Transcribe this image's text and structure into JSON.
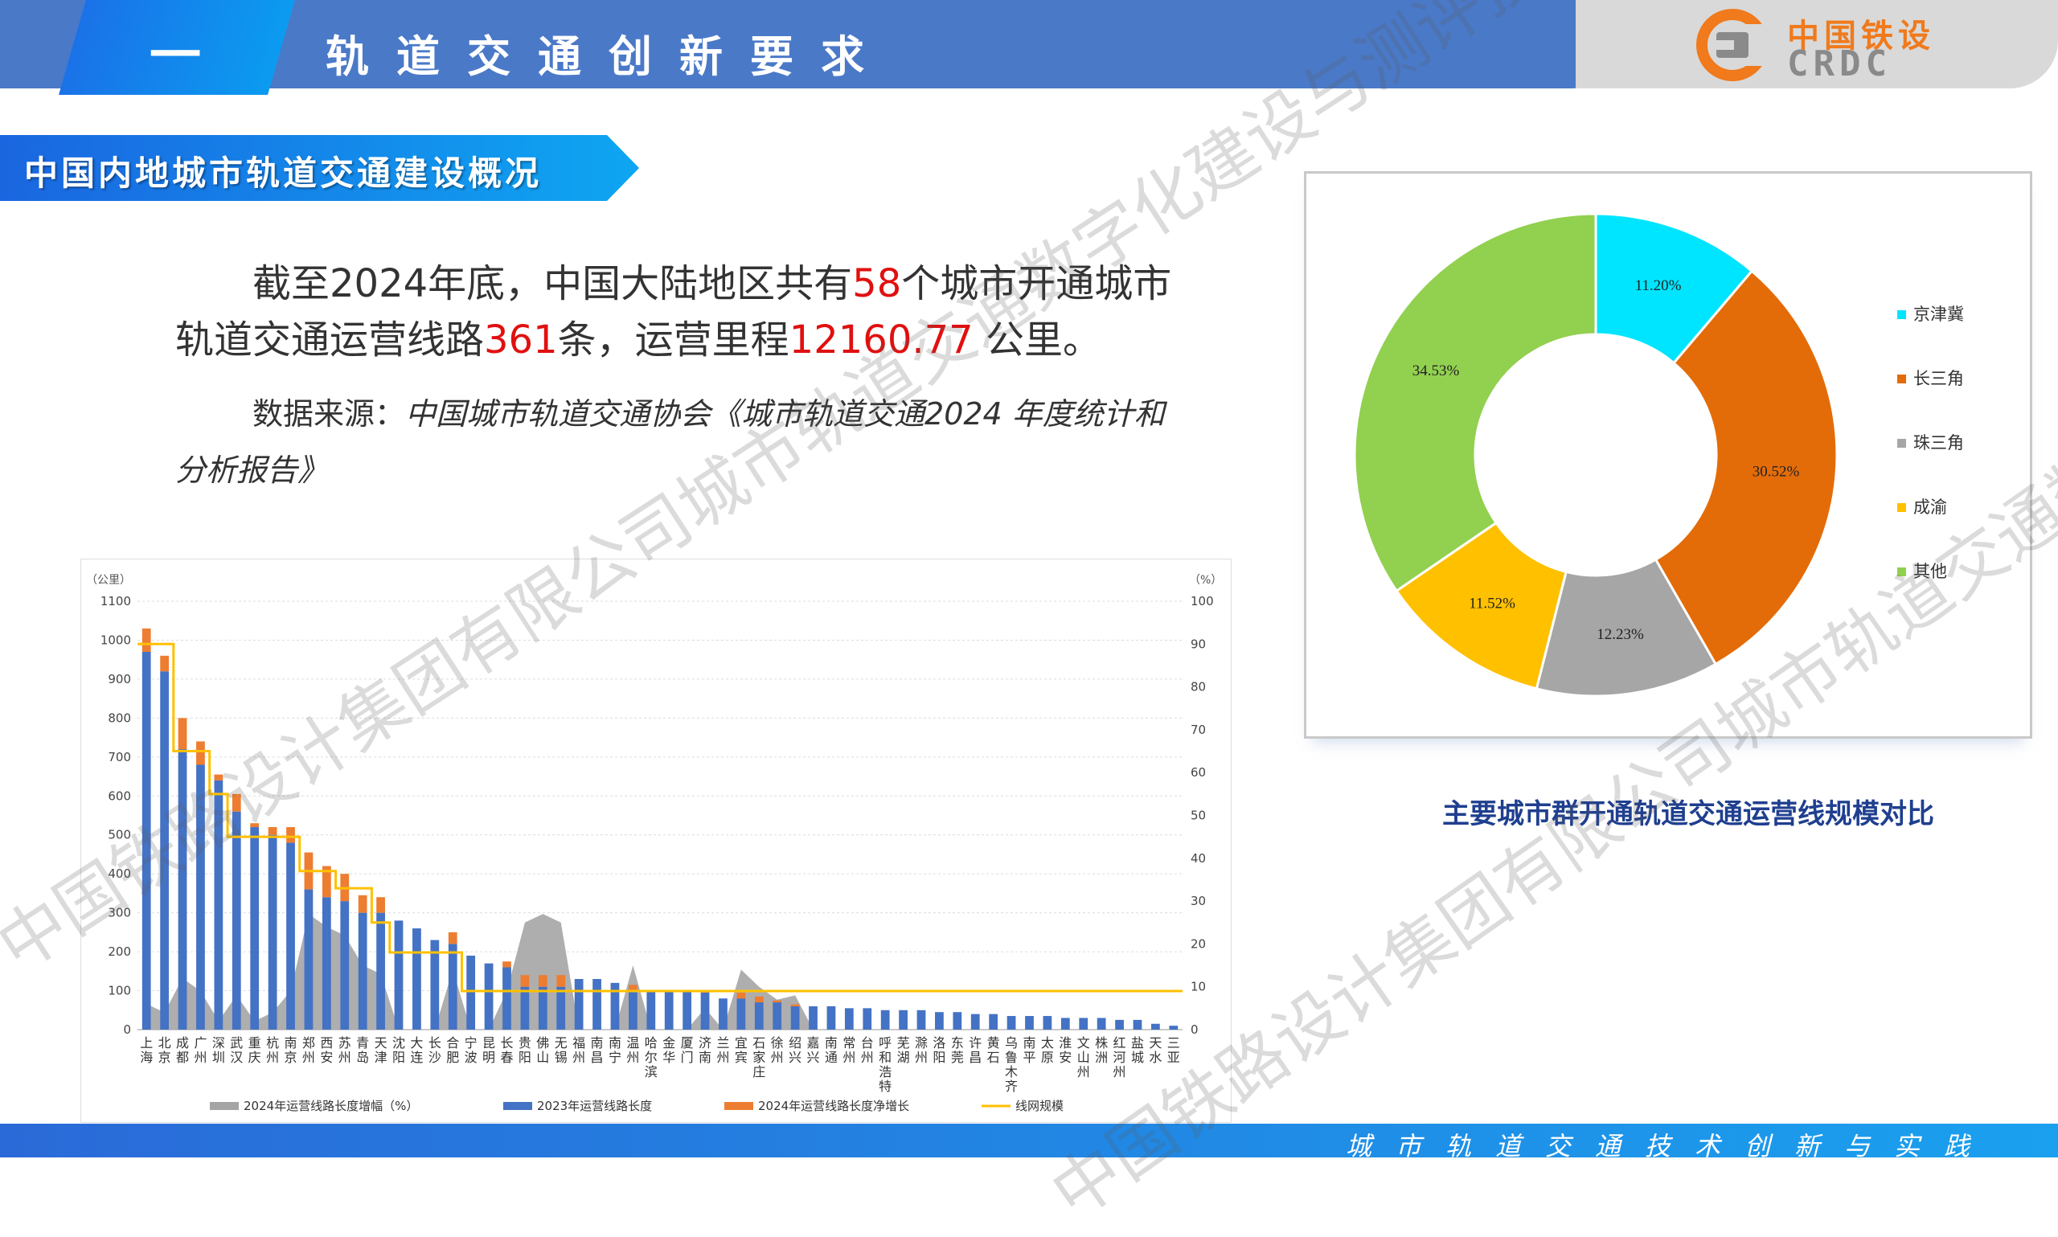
{
  "header": {
    "number": "一",
    "title": "轨道交通创新要求",
    "logo_cn": "中国铁设",
    "logo_en": "CRDC"
  },
  "section_title": "中国内地城市轨道交通建设概况",
  "paragraph": {
    "p1": "截至2024年底，中国大陆地区共有",
    "n1": "58",
    "p2": "个城市开通城市轨道交通运营线路",
    "n2": "361",
    "p3": "条，运营里程",
    "n3": "12160.77",
    "p4": " 公里。"
  },
  "source": {
    "label": "数据来源：",
    "text": "中国城市轨道交通协会《城市轨道交通2024 年度统计和分析报告》"
  },
  "colors": {
    "header_blue": "#4a79c8",
    "bar_blue": "#4472c4",
    "bar_orange": "#ed7d31",
    "area_grey": "#a5a5a5",
    "line_yellow": "#ffc000",
    "highlight_red": "#e01010"
  },
  "chart_data": [
    {
      "type": "bar",
      "left_unit": "（公里）",
      "right_unit": "（%）",
      "ylim": [
        0,
        1100
      ],
      "y2lim": [
        0,
        100
      ],
      "y_ticks": [
        "0",
        "100",
        "200",
        "300",
        "400",
        "500",
        "600",
        "700",
        "800",
        "900",
        "1000",
        "1100"
      ],
      "y2_ticks": [
        "0",
        "10",
        "20",
        "30",
        "40",
        "50",
        "60",
        "70",
        "80",
        "90",
        "100"
      ],
      "categories": [
        "上海",
        "北京",
        "成都",
        "广州",
        "深圳",
        "武汉",
        "重庆",
        "杭州",
        "南京",
        "郑州",
        "西安",
        "苏州",
        "青岛",
        "天津",
        "沈阳",
        "大连",
        "长沙",
        "合肥",
        "宁波",
        "昆明",
        "长春",
        "贵阳",
        "佛山",
        "无锡",
        "福州",
        "南昌",
        "南宁",
        "温州",
        "哈尔滨",
        "金华",
        "厦门",
        "济南",
        "兰州",
        "宜宾",
        "石家庄",
        "徐州",
        "绍兴",
        "嘉兴",
        "南通",
        "常州",
        "台州",
        "呼和浩特",
        "芜湖",
        "滁州",
        "洛阳",
        "东莞",
        "许昌",
        "黄石",
        "乌鲁木齐",
        "南平",
        "太原",
        "淮安",
        "文山州",
        "株洲",
        "红河州",
        "盐城",
        "天水",
        "三亚"
      ],
      "series": [
        {
          "name": "2023年运营线路长度",
          "values": [
            970,
            920,
            720,
            680,
            640,
            560,
            520,
            500,
            480,
            360,
            340,
            330,
            300,
            300,
            280,
            260,
            230,
            220,
            190,
            170,
            160,
            110,
            110,
            110,
            130,
            130,
            120,
            100,
            100,
            100,
            100,
            95,
            80,
            80,
            70,
            70,
            60,
            60,
            60,
            55,
            55,
            50,
            50,
            50,
            45,
            45,
            40,
            40,
            35,
            35,
            35,
            30,
            30,
            30,
            25,
            25,
            15,
            10
          ]
        },
        {
          "name": "2024年运营线路长度净增长",
          "values": [
            60,
            40,
            80,
            60,
            15,
            45,
            10,
            20,
            40,
            95,
            80,
            70,
            45,
            40,
            0,
            0,
            0,
            30,
            0,
            0,
            15,
            30,
            30,
            30,
            0,
            0,
            0,
            15,
            0,
            0,
            0,
            5,
            0,
            15,
            15,
            5,
            5,
            0,
            0,
            0,
            0,
            0,
            0,
            0,
            0,
            0,
            0,
            0,
            0,
            0,
            0,
            0,
            0,
            0,
            0,
            0,
            0,
            0
          ]
        },
        {
          "name": "2024年运营线路长度增幅（%）",
          "values": [
            6,
            4,
            12,
            9,
            2,
            8,
            2,
            4,
            9,
            27,
            24,
            22,
            15,
            13,
            0,
            0,
            0,
            14,
            0,
            0,
            9,
            25,
            27,
            25,
            0,
            0,
            0,
            15,
            0,
            0,
            0,
            5,
            0,
            14,
            10,
            7,
            8,
            0,
            0,
            0,
            0,
            0,
            0,
            0,
            0,
            0,
            0,
            0,
            0,
            0,
            0,
            0,
            0,
            0,
            0,
            0,
            0,
            0
          ]
        },
        {
          "name": "线网规模",
          "values": [
            90,
            90,
            65,
            65,
            55,
            45,
            45,
            45,
            45,
            37,
            37,
            33,
            33,
            25,
            18,
            18,
            18,
            18,
            9,
            9,
            9,
            9,
            9,
            9,
            9,
            9,
            9,
            9,
            9,
            9,
            9,
            9,
            9,
            9,
            9,
            9,
            9,
            9,
            9,
            9,
            9,
            9,
            9,
            9,
            9,
            9,
            9,
            9,
            9,
            9,
            9,
            9,
            9,
            9,
            9,
            9,
            9,
            9
          ]
        }
      ]
    },
    {
      "type": "pie",
      "title": "主要城市群开通轨道交通运营线规模对比",
      "categories": [
        "京津冀",
        "长三角",
        "珠三角",
        "成渝",
        "其他"
      ],
      "values": [
        11.2,
        30.52,
        12.23,
        11.52,
        34.53
      ],
      "labels": [
        "11.20%",
        "30.52%",
        "12.23%",
        "11.52%",
        "34.53%"
      ],
      "colors": [
        "#00e5ff",
        "#e36c09",
        "#a6a6a6",
        "#ffc000",
        "#92d050"
      ],
      "legend_position": "right"
    }
  ],
  "footer": "城市轨道交通技术创新与实践",
  "watermark": "中国铁路设计集团有限公司城市轨道交通数字化建设与测评技术国家工程研究中心粤港澳大湾区分中心"
}
